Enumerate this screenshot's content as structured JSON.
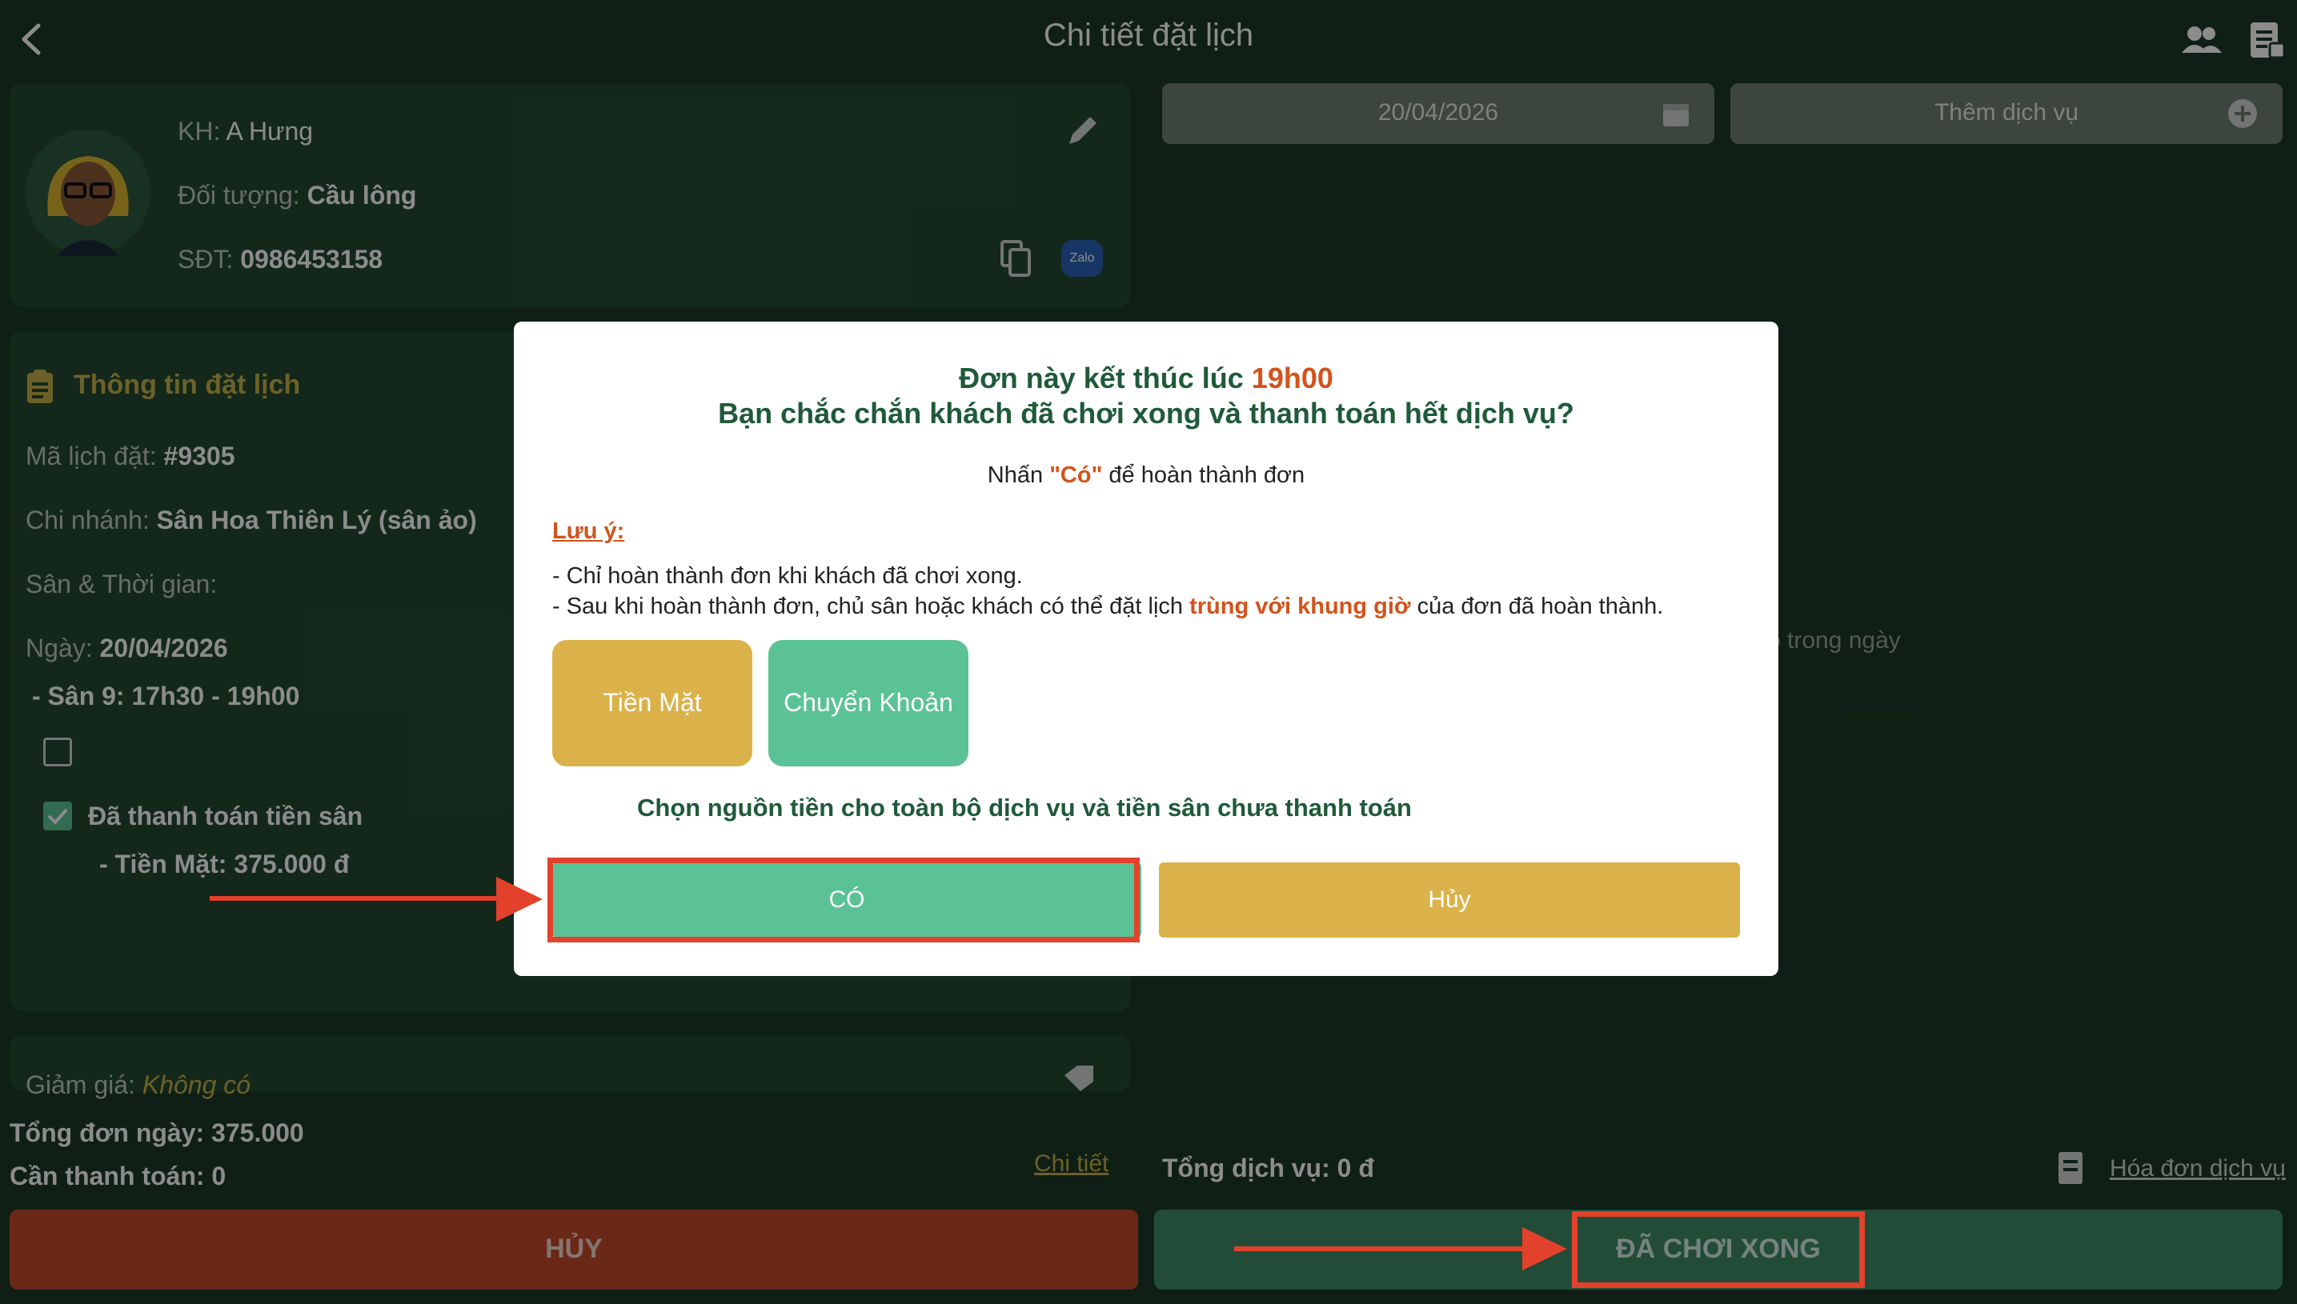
{
  "header": {
    "title": "Chi tiết đặt lịch"
  },
  "customer": {
    "name_label": "KH:",
    "name_value": "A Hưng",
    "target_label": "Đối tượng:",
    "target_value": "Cầu lông",
    "phone_label": "SĐT:",
    "phone_value": "0986453158",
    "zalo_label": "Zalo"
  },
  "booking": {
    "section_title": "Thông tin đặt lịch",
    "code_label": "Mã lịch đặt:",
    "code_value": "#9305",
    "branch_label": "Chi nhánh:",
    "branch_value": "Sân Hoa Thiên Lý (sân ảo)",
    "court_time_label": "Sân & Thời gian:",
    "date_label": "Ngày:",
    "date_value": "20/04/2026",
    "slot": "- Sân 9: 17h30 - 19h00",
    "paid_label": "Đã thanh toán tiền sân",
    "paid_detail": "- Tiền Mặt: 375.000 đ"
  },
  "discount": {
    "label": "Giảm giá:",
    "value": "Không có"
  },
  "totals": {
    "day_total": "Tổng đơn ngày: 375.000",
    "need_pay": "Cần thanh toán: 0",
    "detail_link": "Chi tiết",
    "service_total": "Tổng dịch vụ: 0 đ",
    "service_invoice_link": "Hóa đơn dịch vụ"
  },
  "right_panel": {
    "date": "20/04/2026",
    "add_service": "Thêm dịch vụ",
    "empty_hint": "o trong ngày"
  },
  "actions": {
    "cancel": "HỦY",
    "finished": "ĐÃ CHƠI XONG"
  },
  "modal": {
    "title_prefix": "Đơn này kết thúc lúc ",
    "title_time": "19h00",
    "title_line2": "Bạn chắc chắn khách đã chơi xong và thanh toán hết dịch vụ?",
    "press_prefix": "Nhấn ",
    "press_yes": "\"Có\"",
    "press_suffix": " để hoàn thành đơn",
    "note_label": "Lưu ý:",
    "note1": "- Chỉ hoàn thành đơn khi khách đã chơi xong.",
    "note2_prefix": "- Sau khi hoàn thành đơn, chủ sân hoặc khách có thể đặt lịch ",
    "note2_highlight": "trùng với khung giờ",
    "note2_suffix": " của đơn đã hoàn thành.",
    "cash": "Tiền Mặt",
    "transfer": "Chuyển Khoản",
    "choose_source": "Chọn nguồn tiền cho toàn bộ dịch vụ và tiền sân chưa thanh toán",
    "yes": "CÓ",
    "cancel": "Hủy"
  },
  "colors": {
    "background": "#1d3a27",
    "green_button": "#5bc295",
    "yellow_button": "#dbb24a",
    "cancel_red": "#c2492a",
    "highlight_red": "#e2412c",
    "accent_orange": "#d2531c"
  }
}
